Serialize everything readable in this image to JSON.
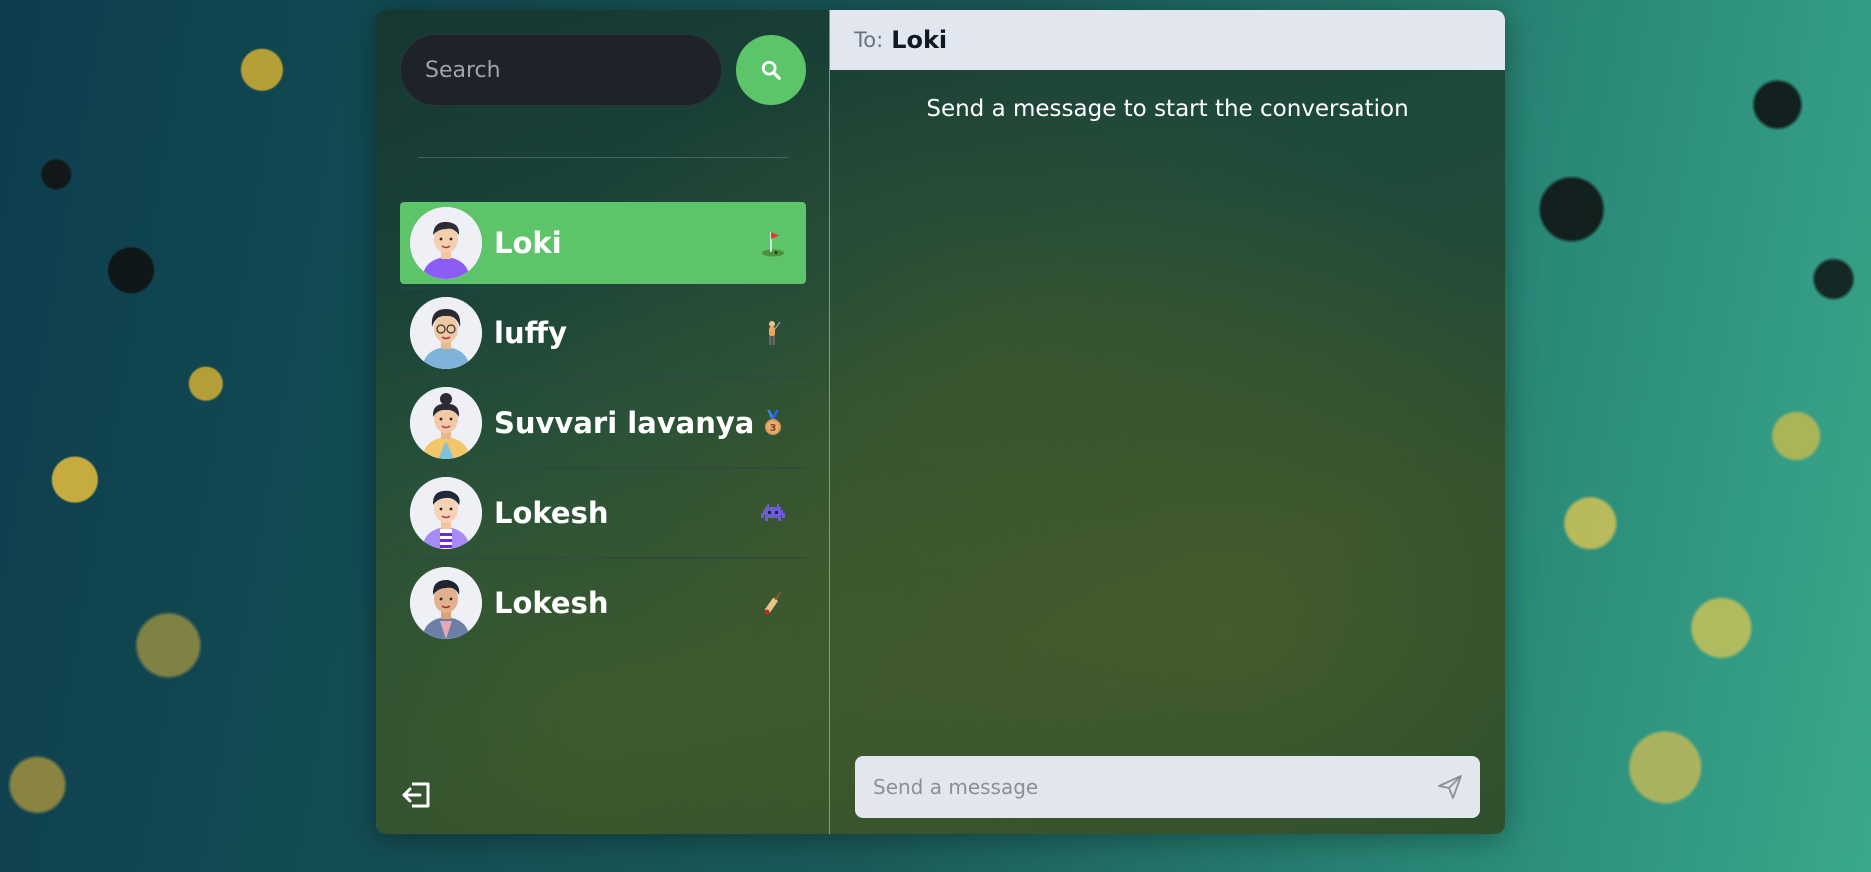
{
  "search": {
    "placeholder": "Search"
  },
  "conversations": [
    {
      "name": "Loki",
      "emoji": "golf-flag",
      "active": true,
      "avatar_color": "#8b5cf6"
    },
    {
      "name": "luffy",
      "emoji": "golfer",
      "active": false,
      "avatar_color": "#7fb3d9"
    },
    {
      "name": "Suvvari lavanya",
      "emoji": "bronze-medal",
      "active": false,
      "avatar_color": "#f4c66a"
    },
    {
      "name": "Lokesh",
      "emoji": "alien-monster",
      "active": false,
      "avatar_color": "#a78bfa"
    },
    {
      "name": "Lokesh",
      "emoji": "cricket-bat",
      "active": false,
      "avatar_color": "#6b7fa8"
    }
  ],
  "chat": {
    "to_label": "To:",
    "to_name": "Loki",
    "empty_message": "Send a message to start the conversation",
    "input_placeholder": "Send a message"
  },
  "colors": {
    "accent": "#5ec46a",
    "header_bg": "#e2e6ef",
    "search_bg": "#1e2229"
  }
}
